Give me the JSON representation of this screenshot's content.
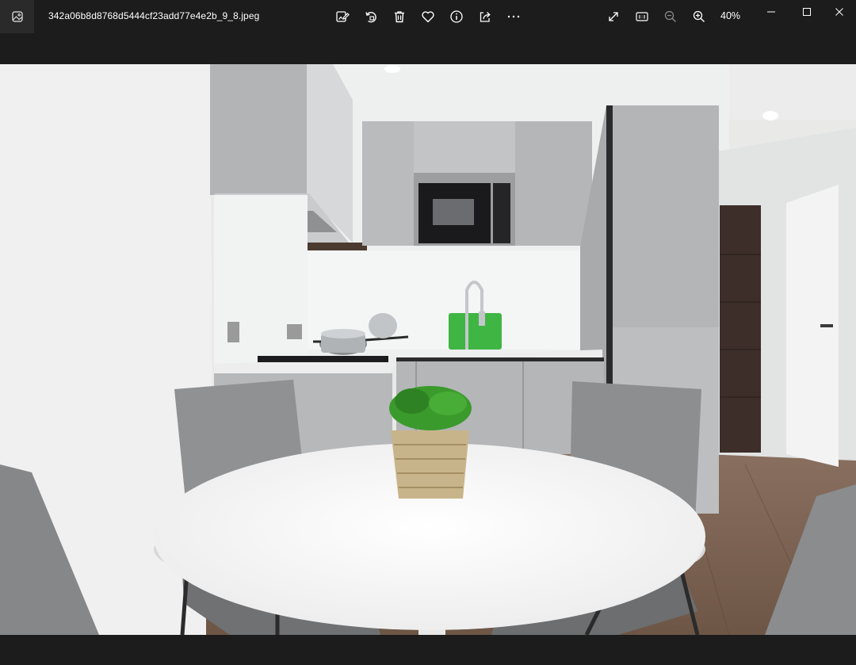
{
  "titlebar": {
    "filename": "342a06b8d8768d5444cf23add77e4e2b_9_8.jpeg",
    "zoom": "40%"
  },
  "toolbar": {
    "icons": [
      "edit-image-icon",
      "rotate-icon",
      "delete-icon",
      "favorite-icon",
      "file-info-icon",
      "share-icon",
      "more-icon"
    ]
  },
  "view_controls": {
    "icons": [
      "fullscreen-icon",
      "actual-size-icon",
      "zoom-out-icon",
      "zoom-in-icon"
    ]
  },
  "window_controls": {
    "icons": [
      "minimize-icon",
      "maximize-icon",
      "close-icon"
    ]
  },
  "photo": {
    "subject": "kitchen-dining-room-photo"
  }
}
